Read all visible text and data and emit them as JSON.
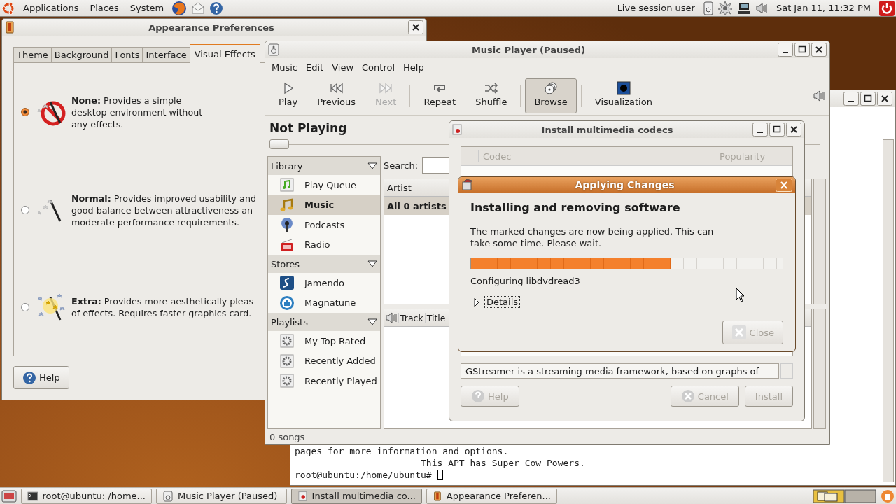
{
  "top_panel": {
    "menus": [
      "Applications",
      "Places",
      "System"
    ],
    "user": "Live session user",
    "clock": "Sat Jan 11, 11:32 PM"
  },
  "terminal": {
    "lines": [
      "pages for more information and options.",
      "                       This APT has Super Cow Powers.",
      "root@ubuntu:/home/ubuntu# "
    ]
  },
  "appearance_window": {
    "title": "Appearance Preferences",
    "tabs": [
      {
        "label": "Theme",
        "selected": false
      },
      {
        "label": "Background",
        "selected": false
      },
      {
        "label": "Fonts",
        "selected": false
      },
      {
        "label": "Interface",
        "selected": false
      },
      {
        "label": "Visual Effects",
        "selected": true
      }
    ],
    "options": [
      {
        "kind": "none",
        "selected": true,
        "lines": [
          "**None:** Provides a simple",
          "desktop environment without",
          "any effects."
        ]
      },
      {
        "kind": "normal",
        "selected": false,
        "lines": [
          "**Normal:** Provides improved usability and",
          "good balance between attractiveness an",
          "moderate performance requirements."
        ]
      },
      {
        "kind": "extra",
        "selected": false,
        "lines": [
          "**Extra:** Provides more aesthetically pleas",
          "of effects. Requires faster graphics card."
        ]
      }
    ],
    "help_button": "Help"
  },
  "music_player": {
    "title": "Music Player (Paused)",
    "menus": [
      "Music",
      "Edit",
      "View",
      "Control",
      "Help"
    ],
    "toolbar_groups": [
      [
        {
          "kind": "play",
          "label": "Play",
          "disabled": false,
          "selected": false
        },
        {
          "kind": "previous",
          "label": "Previous",
          "disabled": false,
          "selected": false
        },
        {
          "kind": "next",
          "label": "Next",
          "disabled": true,
          "selected": false
        }
      ],
      [
        {
          "kind": "repeat",
          "label": "Repeat",
          "disabled": false,
          "selected": false
        },
        {
          "kind": "shuffle",
          "label": "Shuffle",
          "disabled": false,
          "selected": false
        }
      ],
      [
        {
          "kind": "browse",
          "label": "Browse",
          "disabled": false,
          "selected": true
        }
      ],
      [
        {
          "kind": "visualization",
          "label": "Visualization",
          "disabled": false,
          "selected": false
        }
      ]
    ],
    "now_playing": "Not Playing",
    "position": {
      "level": 0
    },
    "sections": [
      {
        "title": "Library",
        "expanded": true,
        "items": [
          {
            "kind": "queue",
            "label": "Play Queue",
            "selected": false
          },
          {
            "kind": "music",
            "label": "Music",
            "selected": true
          },
          {
            "kind": "podcast",
            "label": "Podcasts",
            "selected": false
          },
          {
            "kind": "radio",
            "label": "Radio",
            "selected": false
          }
        ]
      },
      {
        "title": "Stores",
        "expanded": true,
        "items": [
          {
            "kind": "jamendo",
            "label": "Jamendo",
            "selected": false
          },
          {
            "kind": "magnatune",
            "label": "Magnatune",
            "selected": false
          }
        ]
      },
      {
        "title": "Playlists",
        "expanded": true,
        "items": [
          {
            "kind": "playlist",
            "label": "My Top Rated",
            "selected": false
          },
          {
            "kind": "playlist",
            "label": "Recently Added",
            "selected": false
          },
          {
            "kind": "playlist",
            "label": "Recently Played",
            "selected": false
          }
        ]
      }
    ],
    "search_label": "Search:",
    "artist_column": "Artist",
    "artist_row": "All 0 artists",
    "track_columns": [
      "Track",
      "Title"
    ],
    "status": "0 songs"
  },
  "codec_window": {
    "title": "Install multimedia codecs",
    "columns": [
      "Codec",
      "Popularity"
    ],
    "description": "GStreamer is a streaming media framework, based on graphs of",
    "buttons": [
      {
        "kind": "help",
        "label": "Help",
        "disabled": true
      },
      {
        "kind": "cancel",
        "label": "Cancel",
        "disabled": true
      },
      {
        "kind": "install",
        "label": "Install",
        "disabled": true
      }
    ]
  },
  "applying_dialog": {
    "title": "Applying Changes",
    "heading": "Installing and removing software",
    "message": "The marked changes are now being applied. This can take some time. Please wait.",
    "progress": {
      "level": 0.64
    },
    "status": "Configuring libdvdread3",
    "details": {
      "label": "Details",
      "expanded": false
    },
    "close_button": {
      "label": "Close",
      "disabled": true
    }
  },
  "taskbar": [
    {
      "kind": "terminal",
      "label": "root@ubuntu: /home...",
      "selected": false
    },
    {
      "kind": "music",
      "label": "Music Player (Paused)",
      "selected": false
    },
    {
      "kind": "codec",
      "label": "Install multimedia co...",
      "selected": true
    },
    {
      "kind": "appearance",
      "label": "Appearance Preferen...",
      "selected": false
    }
  ]
}
